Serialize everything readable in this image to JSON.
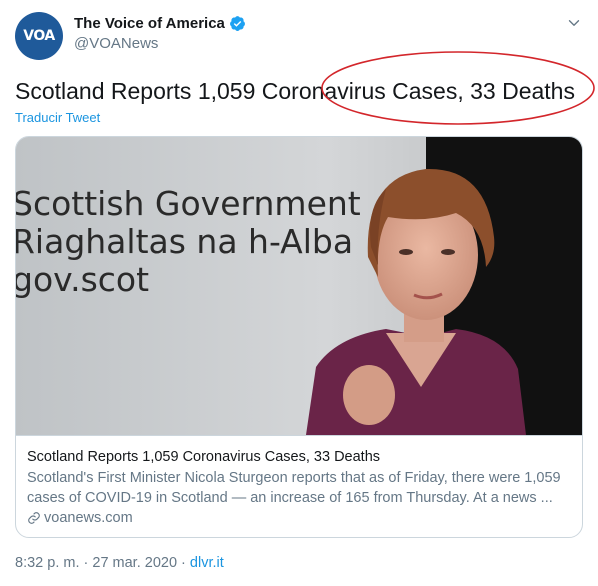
{
  "account": {
    "display_name": "The Voice of America",
    "handle": "@VOANews",
    "avatar_text": "VOA"
  },
  "tweet": {
    "text": "Scotland Reports 1,059 Coronavirus Cases, 33 Deaths",
    "translate_label": "Traducir Tweet"
  },
  "card": {
    "image_text": {
      "line1": "Scottish Government",
      "line2": "Riaghaltas na h-Alba",
      "line3": "gov.scot"
    },
    "title": "Scotland Reports 1,059 Coronavirus Cases, 33 Deaths",
    "description_line1": "Scotland's First Minister Nicola Sturgeon reports that as of Friday, there were 1,059",
    "description_line2": "cases of COVID-19 in Scotland — an increase of 165 from Thursday.   At a news ...",
    "domain": "voanews.com"
  },
  "footer": {
    "time": "8:32 p. m.",
    "separator1": " · ",
    "date": "27 mar. 2020",
    "separator2": " · ",
    "source": "dlvr.it"
  },
  "colors": {
    "link": "#1b95e0",
    "secondary_text": "#657786",
    "verified": "#1da1f2",
    "annotation": "#d3262b",
    "avatar_bg": "#1f5a9a"
  },
  "icons": [
    "verified-badge-icon",
    "chevron-down-icon",
    "link-icon"
  ]
}
